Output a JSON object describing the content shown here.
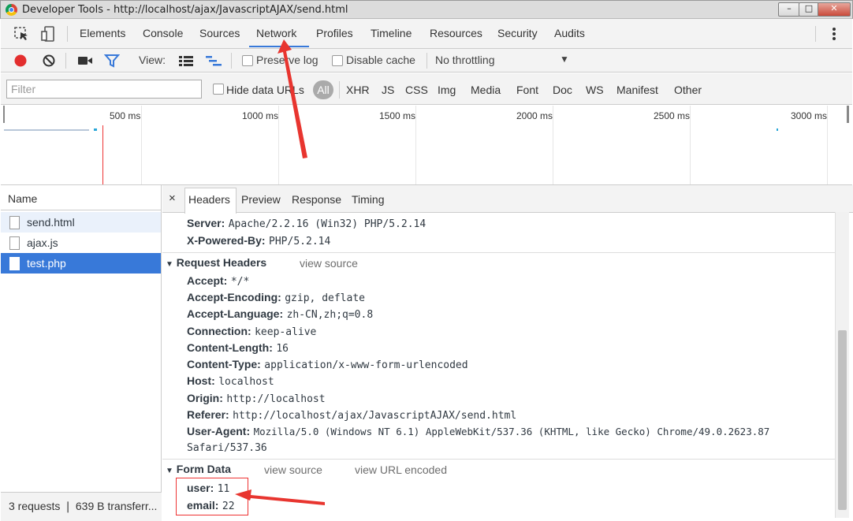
{
  "window": {
    "title": "Developer Tools - http://localhost/ajax/JavascriptAJAX/send.html",
    "controls": [
      "minimize",
      "maximize",
      "close"
    ]
  },
  "main_tabs": [
    "Elements",
    "Console",
    "Sources",
    "Network",
    "Profiles",
    "Timeline",
    "Resources",
    "Security",
    "Audits"
  ],
  "selected_tab": "Network",
  "toolbar": {
    "view_label": "View:",
    "preserve_log": "Preserve log",
    "disable_cache": "Disable cache",
    "throttling": "No throttling"
  },
  "filter": {
    "placeholder": "Filter",
    "hide_data_urls": "Hide data URLs",
    "types": [
      "All",
      "XHR",
      "JS",
      "CSS",
      "Img",
      "Media",
      "Font",
      "Doc",
      "WS",
      "Manifest",
      "Other"
    ]
  },
  "timeline": {
    "labels": [
      "500 ms",
      "1000 ms",
      "1500 ms",
      "2000 ms",
      "2500 ms",
      "3000 ms"
    ]
  },
  "requests": {
    "header": "Name",
    "files": [
      "send.html",
      "ajax.js",
      "test.php"
    ],
    "selected": "test.php",
    "status": "3 requests ❘ 639 B transferr..."
  },
  "detail": {
    "close": "×",
    "tabs": [
      "Headers",
      "Preview",
      "Response",
      "Timing"
    ],
    "response_headers": [
      {
        "key": "Server:",
        "value": "Apache/2.2.16 (Win32) PHP/5.2.14"
      },
      {
        "key": "X-Powered-By:",
        "value": "PHP/5.2.14"
      }
    ],
    "request_section": "Request Headers",
    "view_source": "view source",
    "request_headers": [
      {
        "key": "Accept:",
        "value": "*/*"
      },
      {
        "key": "Accept-Encoding:",
        "value": "gzip, deflate"
      },
      {
        "key": "Accept-Language:",
        "value": "zh-CN,zh;q=0.8"
      },
      {
        "key": "Connection:",
        "value": "keep-alive"
      },
      {
        "key": "Content-Length:",
        "value": "16"
      },
      {
        "key": "Content-Type:",
        "value": "application/x-www-form-urlencoded"
      },
      {
        "key": "Host:",
        "value": "localhost"
      },
      {
        "key": "Origin:",
        "value": "http://localhost"
      },
      {
        "key": "Referer:",
        "value": "http://localhost/ajax/JavascriptAJAX/send.html"
      },
      {
        "key": "User-Agent:",
        "value": "Mozilla/5.0 (Windows NT 6.1) AppleWebKit/537.36 (KHTML, like Gecko) Chrome/49.0.2623.87"
      }
    ],
    "user_agent_wrap": "Safari/537.36",
    "form_section": "Form Data",
    "view_url_encoded": "view URL encoded",
    "form_data": [
      {
        "key": "user:",
        "value": "11"
      },
      {
        "key": "email:",
        "value": "22"
      }
    ]
  },
  "colors": {
    "accent": "#3879d9",
    "selected_row": "#3879d9",
    "annotation": "#e8352f",
    "record": "#e32e2e"
  }
}
